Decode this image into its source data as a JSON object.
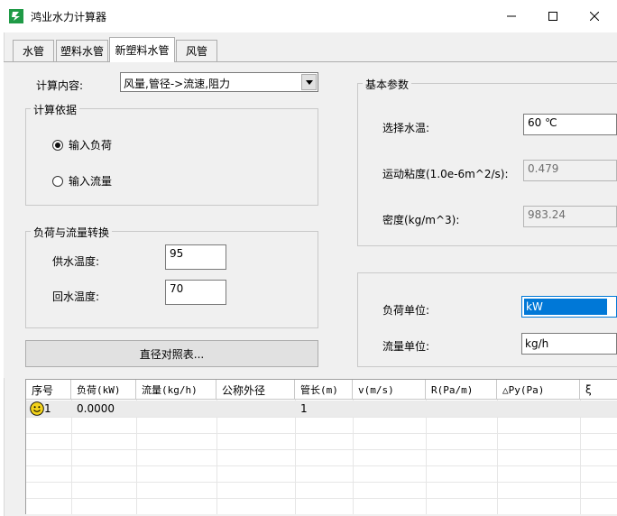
{
  "window": {
    "title": "鸿业水力计算器"
  },
  "tabs": [
    {
      "label": "水管",
      "active": false
    },
    {
      "label": "塑料水管",
      "active": false
    },
    {
      "label": "新塑料水管",
      "active": true
    },
    {
      "label": "风管",
      "active": false
    }
  ],
  "calc": {
    "content_label": "计算内容:",
    "content_value": "风量,管径->流速,阻力"
  },
  "basis": {
    "title": "计算依据",
    "options": [
      {
        "label": "输入负荷",
        "checked": true
      },
      {
        "label": "输入流量",
        "checked": false
      }
    ]
  },
  "conversion": {
    "title": "负荷与流量转换",
    "supply_label": "供水温度:",
    "supply_value": "95",
    "return_label": "回水温度:",
    "return_value": "70"
  },
  "diameter_button": "直径对照表...",
  "params": {
    "title": "基本参数",
    "temp_label": "选择水温:",
    "temp_value": "60 ℃",
    "viscosity_label": "运动粘度(1.0e-6m^2/s):",
    "viscosity_value": "0.479",
    "density_label": "密度(kg/m^3):",
    "density_value": "983.24"
  },
  "units": {
    "load_label": "负荷单位:",
    "load_value": "kW",
    "flow_label": "流量单位:",
    "flow_value": "kg/h"
  },
  "grid": {
    "columns": [
      "序号",
      "负荷(kW)",
      "流量(kg/h)",
      "公称外径",
      "管长(m)",
      "v(m/s)",
      "R(Pa/m)",
      "△Py(Pa)",
      "ξ"
    ],
    "rows": [
      {
        "index": "1",
        "load": "0.0000",
        "flow": "",
        "diameter": "",
        "length": "1"
      }
    ]
  },
  "colors": {
    "selection": "#0078d7",
    "icon_green": "#1f9a46",
    "smiley": "#f2d21b"
  }
}
